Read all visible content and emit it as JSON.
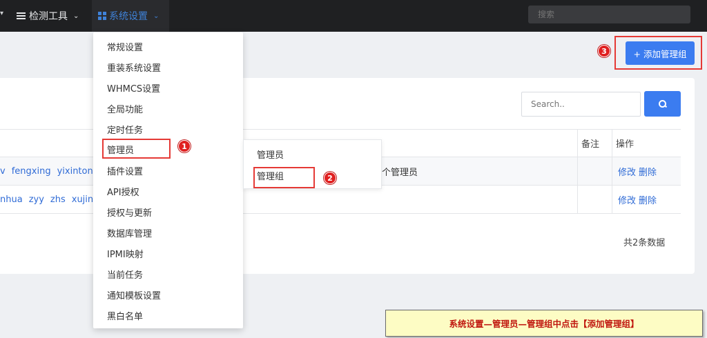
{
  "nav": {
    "tools_label": "检测工具",
    "settings_label": "系统设置",
    "search_placeholder": "搜索"
  },
  "add_group_button": "+ 添加管理组",
  "dropdown": {
    "items": [
      "常规设置",
      "重装系统设置",
      "WHMCS设置",
      "全局功能",
      "定时任务",
      "管理员",
      "插件设置",
      "API授权",
      "授权与更新",
      "数据库管理",
      "IPMI映射",
      "当前任务",
      "通知模板设置",
      "黑白名单"
    ]
  },
  "submenu": {
    "items": [
      "管理员",
      "管理组"
    ]
  },
  "markers": [
    "1",
    "2",
    "3"
  ],
  "table": {
    "search_placeholder": "Search..",
    "headers": {
      "remark": "备注",
      "actions": "操作"
    },
    "rows": [
      {
        "members": [
          "v",
          "fengxing",
          "yixintong"
        ],
        "desc": "个管理员",
        "actions": [
          "修改",
          "删除"
        ]
      },
      {
        "members": [
          "nhua",
          "zyy",
          "zhs",
          "xujin"
        ],
        "desc": "",
        "actions": [
          "修改",
          "删除"
        ]
      }
    ],
    "total": "共2条数据"
  },
  "note": "系统设置—管理员—管理组中点击【添加管理组】",
  "colors": {
    "accent": "#3b7cf0",
    "highlight": "#e53935",
    "nav_bg": "#1f2022"
  }
}
